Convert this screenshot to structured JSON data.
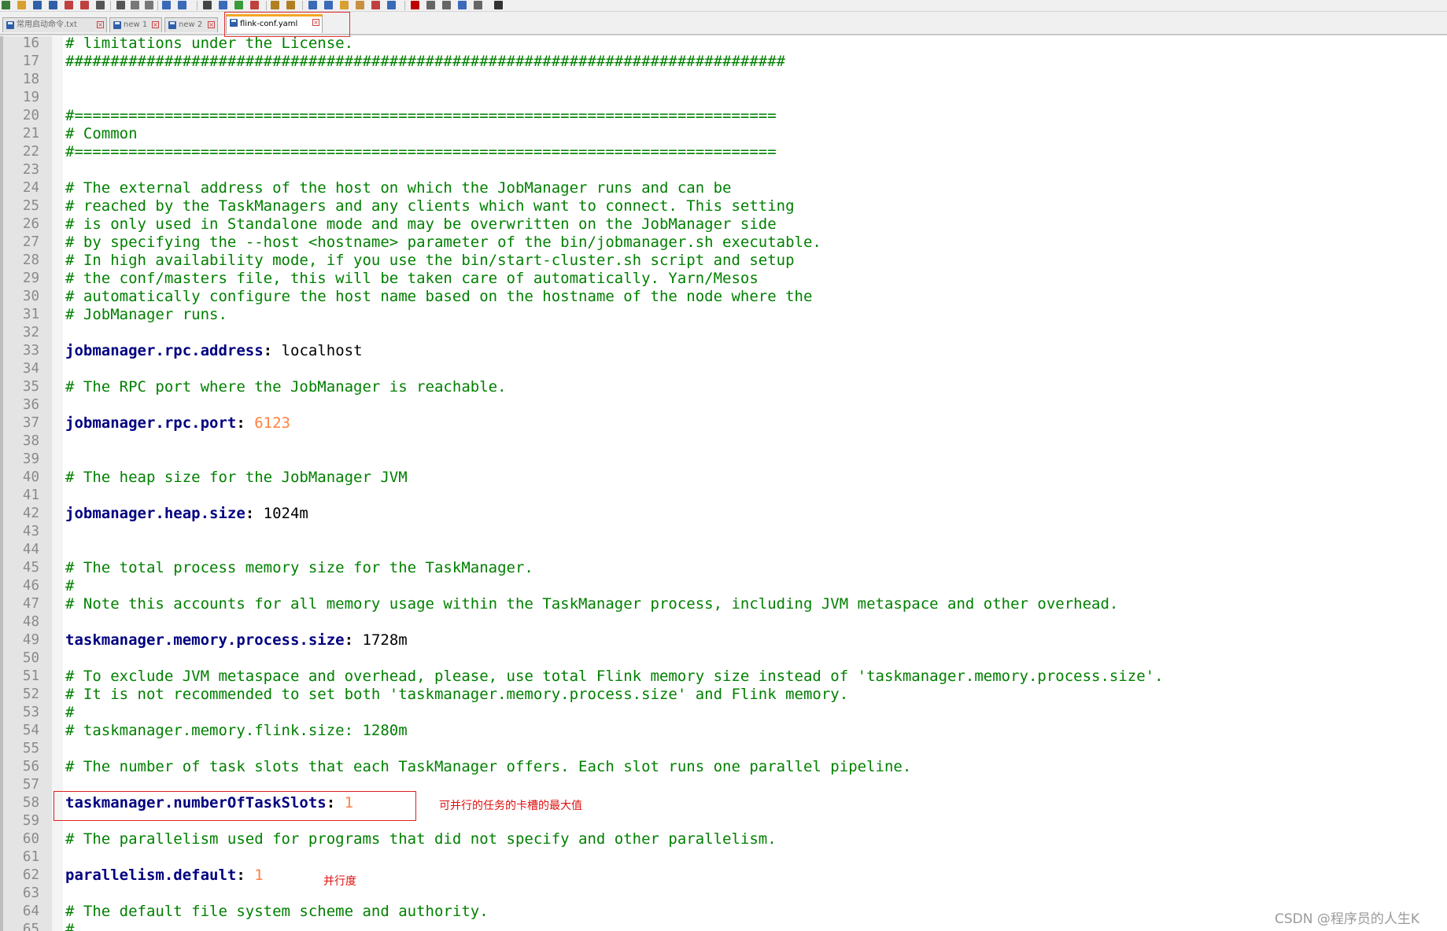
{
  "tabs": [
    {
      "label": "常用启动命令.txt",
      "active": false
    },
    {
      "label": "new 1",
      "active": false
    },
    {
      "label": "new 2",
      "active": false
    },
    {
      "label": "flink-conf.yaml",
      "active": true
    }
  ],
  "toolbar": {
    "icons": [
      "new-file-icon",
      "open-file-icon",
      "save-icon",
      "save-all-icon",
      "close-icon",
      "close-all-icon",
      "print-icon",
      "cut-icon",
      "copy-icon",
      "paste-icon",
      "undo-icon",
      "redo-icon",
      "find-icon",
      "replace-icon",
      "zoom-in-icon",
      "zoom-out-icon",
      "sync-scroll-icon",
      "word-wrap-icon",
      "show-all-chars-icon",
      "indent-guide-icon",
      "udl-icon",
      "doc-map-icon",
      "function-list-icon",
      "monitor-icon",
      "record-macro-icon",
      "stop-record-icon",
      "play-macro-icon",
      "run-macro-icon",
      "save-macro-icon",
      "spell-check-icon"
    ]
  },
  "editor": {
    "lines": [
      {
        "n": "16",
        "tokens": [
          {
            "t": "# limitations under the License.",
            "c": "comment"
          }
        ]
      },
      {
        "n": "17",
        "tokens": [
          {
            "t": "################################################################################",
            "c": "comment"
          }
        ]
      },
      {
        "n": "18",
        "tokens": []
      },
      {
        "n": "19",
        "tokens": []
      },
      {
        "n": "20",
        "tokens": [
          {
            "t": "#==============================================================================",
            "c": "comment"
          }
        ]
      },
      {
        "n": "21",
        "tokens": [
          {
            "t": "# Common",
            "c": "comment"
          }
        ]
      },
      {
        "n": "22",
        "tokens": [
          {
            "t": "#==============================================================================",
            "c": "comment"
          }
        ]
      },
      {
        "n": "23",
        "tokens": []
      },
      {
        "n": "24",
        "tokens": [
          {
            "t": "# The external address of the host on which the JobManager runs and can be",
            "c": "comment"
          }
        ]
      },
      {
        "n": "25",
        "tokens": [
          {
            "t": "# reached by the TaskManagers and any clients which want to connect. This setting",
            "c": "comment"
          }
        ]
      },
      {
        "n": "26",
        "tokens": [
          {
            "t": "# is only used in Standalone mode and may be overwritten on the JobManager side",
            "c": "comment"
          }
        ]
      },
      {
        "n": "27",
        "tokens": [
          {
            "t": "# by specifying the --host <hostname> parameter of the bin/jobmanager.sh executable.",
            "c": "comment"
          }
        ]
      },
      {
        "n": "28",
        "tokens": [
          {
            "t": "# In high availability mode, if you use the bin/start-cluster.sh script and setup",
            "c": "comment"
          }
        ]
      },
      {
        "n": "29",
        "tokens": [
          {
            "t": "# the conf/masters file, this will be taken care of automatically. Yarn/Mesos",
            "c": "comment"
          }
        ]
      },
      {
        "n": "30",
        "tokens": [
          {
            "t": "# automatically configure the host name based on the hostname of the node where the",
            "c": "comment"
          }
        ]
      },
      {
        "n": "31",
        "tokens": [
          {
            "t": "# JobManager runs.",
            "c": "comment"
          }
        ]
      },
      {
        "n": "32",
        "tokens": []
      },
      {
        "n": "33",
        "tokens": [
          {
            "t": "jobmanager.rpc.address",
            "c": "key"
          },
          {
            "t": ": ",
            "c": "colon"
          },
          {
            "t": "localhost",
            "c": "value"
          }
        ]
      },
      {
        "n": "34",
        "tokens": []
      },
      {
        "n": "35",
        "tokens": [
          {
            "t": "# The RPC port where the JobManager is reachable.",
            "c": "comment"
          }
        ]
      },
      {
        "n": "36",
        "tokens": []
      },
      {
        "n": "37",
        "tokens": [
          {
            "t": "jobmanager.rpc.port",
            "c": "key"
          },
          {
            "t": ": ",
            "c": "colon"
          },
          {
            "t": "6123",
            "c": "num"
          }
        ]
      },
      {
        "n": "38",
        "tokens": []
      },
      {
        "n": "39",
        "tokens": []
      },
      {
        "n": "40",
        "tokens": [
          {
            "t": "# The heap size for the JobManager JVM",
            "c": "comment"
          }
        ]
      },
      {
        "n": "41",
        "tokens": []
      },
      {
        "n": "42",
        "tokens": [
          {
            "t": "jobmanager.heap.size",
            "c": "key"
          },
          {
            "t": ": ",
            "c": "colon"
          },
          {
            "t": "1024m",
            "c": "value"
          }
        ]
      },
      {
        "n": "43",
        "tokens": []
      },
      {
        "n": "44",
        "tokens": []
      },
      {
        "n": "45",
        "tokens": [
          {
            "t": "# The total process memory size for the TaskManager.",
            "c": "comment"
          }
        ]
      },
      {
        "n": "46",
        "tokens": [
          {
            "t": "#",
            "c": "comment"
          }
        ]
      },
      {
        "n": "47",
        "tokens": [
          {
            "t": "# Note this accounts for all memory usage within the TaskManager process, including JVM metaspace and other overhead.",
            "c": "comment"
          }
        ]
      },
      {
        "n": "48",
        "tokens": []
      },
      {
        "n": "49",
        "tokens": [
          {
            "t": "taskmanager.memory.process.size",
            "c": "key"
          },
          {
            "t": ": ",
            "c": "colon"
          },
          {
            "t": "1728m",
            "c": "value"
          }
        ]
      },
      {
        "n": "50",
        "tokens": []
      },
      {
        "n": "51",
        "tokens": [
          {
            "t": "# To exclude JVM metaspace and overhead, please, use total Flink memory size instead of 'taskmanager.memory.process.size'.",
            "c": "comment"
          }
        ]
      },
      {
        "n": "52",
        "tokens": [
          {
            "t": "# It is not recommended to set both 'taskmanager.memory.process.size' and Flink memory.",
            "c": "comment"
          }
        ]
      },
      {
        "n": "53",
        "tokens": [
          {
            "t": "#",
            "c": "comment"
          }
        ]
      },
      {
        "n": "54",
        "tokens": [
          {
            "t": "# taskmanager.memory.flink.size: 1280m",
            "c": "comment"
          }
        ]
      },
      {
        "n": "55",
        "tokens": []
      },
      {
        "n": "56",
        "tokens": [
          {
            "t": "# The number of task slots that each TaskManager offers. Each slot runs one parallel pipeline.",
            "c": "comment"
          }
        ]
      },
      {
        "n": "57",
        "tokens": []
      },
      {
        "n": "58",
        "tokens": [
          {
            "t": "taskmanager.numberOfTaskSlots",
            "c": "key"
          },
          {
            "t": ": ",
            "c": "colon"
          },
          {
            "t": "1",
            "c": "num"
          }
        ]
      },
      {
        "n": "59",
        "tokens": []
      },
      {
        "n": "60",
        "tokens": [
          {
            "t": "# The parallelism used for programs that did not specify and other parallelism.",
            "c": "comment"
          }
        ]
      },
      {
        "n": "61",
        "tokens": []
      },
      {
        "n": "62",
        "tokens": [
          {
            "t": "parallelism.default",
            "c": "key"
          },
          {
            "t": ": ",
            "c": "colon"
          },
          {
            "t": "1",
            "c": "num"
          }
        ]
      },
      {
        "n": "63",
        "tokens": []
      },
      {
        "n": "64",
        "tokens": [
          {
            "t": "# The default file system scheme and authority.",
            "c": "comment"
          }
        ]
      },
      {
        "n": "65",
        "tokens": [
          {
            "t": "#",
            "c": "comment"
          }
        ]
      }
    ]
  },
  "annotations": {
    "slots_note": "可并行的任务的卡槽的最大值",
    "parallelism_note": "并行度"
  },
  "watermark": "CSDN @程序员的人生K",
  "colors": {
    "comment": "#008000",
    "key": "#000080",
    "number": "#ff8040",
    "annotation": "#e01010",
    "active_tab_accent": "#f5a623"
  }
}
